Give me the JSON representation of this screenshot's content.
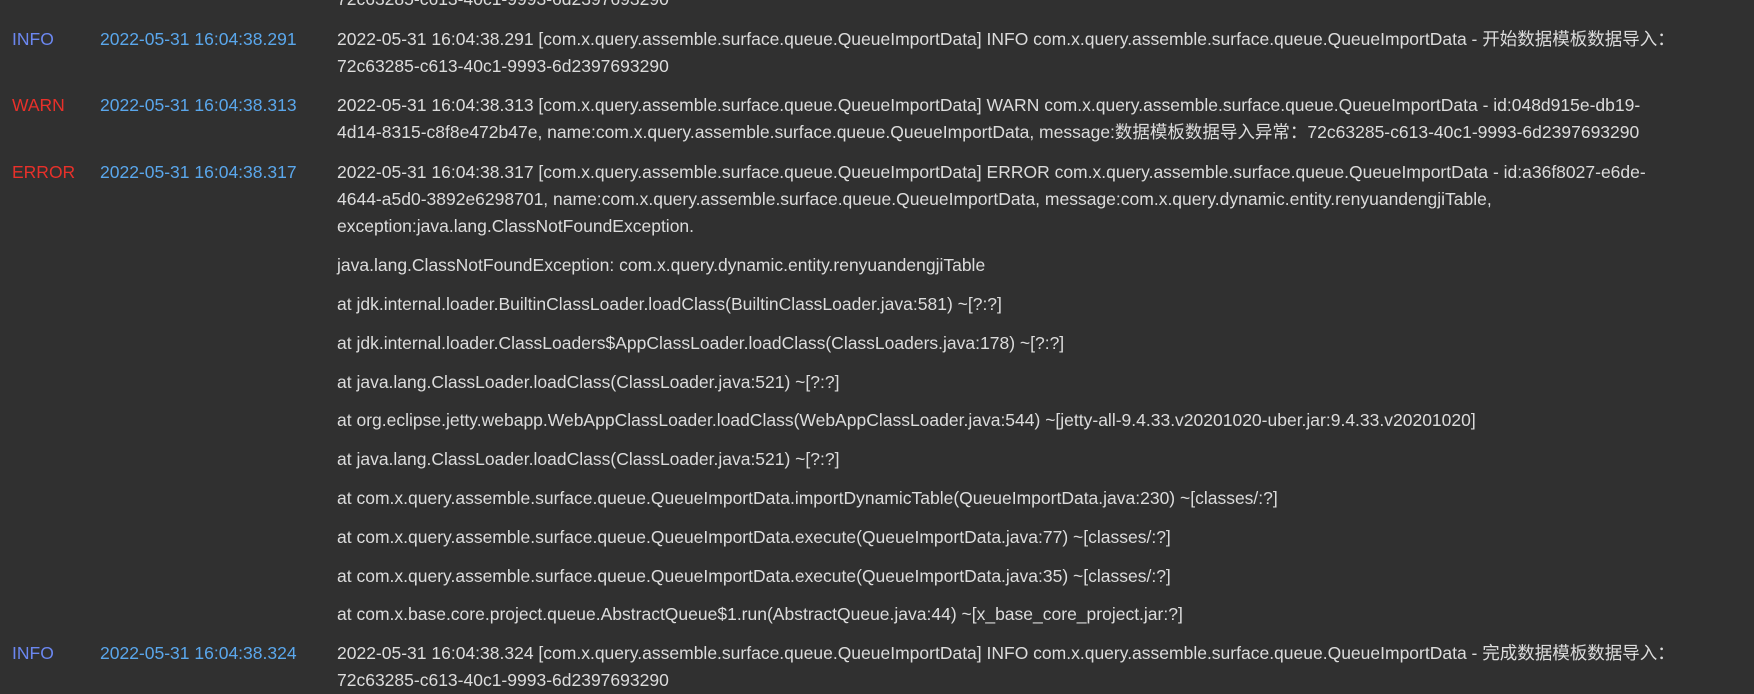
{
  "top_fragment": "72c63285-c613-40c1-9993-6d2397693290",
  "entries": [
    {
      "level": "INFO",
      "time": "2022-05-31 16:04:38.291",
      "message": "2022-05-31 16:04:38.291 [com.x.query.assemble.surface.queue.QueueImportData] INFO com.x.query.assemble.surface.queue.QueueImportData - 开始数据模板数据导入：\n72c63285-c613-40c1-9993-6d2397693290"
    },
    {
      "level": "WARN",
      "time": "2022-05-31 16:04:38.313",
      "message": "2022-05-31 16:04:38.313 [com.x.query.assemble.surface.queue.QueueImportData] WARN com.x.query.assemble.surface.queue.QueueImportData - id:048d915e-db19-\n4d14-8315-c8f8e472b47e, name:com.x.query.assemble.surface.queue.QueueImportData, message:数据模板数据导入异常：72c63285-c613-40c1-9993-6d2397693290"
    },
    {
      "level": "ERROR",
      "time": "2022-05-31 16:04:38.317",
      "message": "2022-05-31 16:04:38.317 [com.x.query.assemble.surface.queue.QueueImportData] ERROR com.x.query.assemble.surface.queue.QueueImportData - id:a36f8027-e6de-\n4644-a5d0-3892e6298701, name:com.x.query.assemble.surface.queue.QueueImportData, message:com.x.query.dynamic.entity.renyuandengjiTable,\nexception:java.lang.ClassNotFoundException.",
      "trace": [
        "java.lang.ClassNotFoundException: com.x.query.dynamic.entity.renyuandengjiTable",
        "at jdk.internal.loader.BuiltinClassLoader.loadClass(BuiltinClassLoader.java:581) ~[?:?]",
        "at jdk.internal.loader.ClassLoaders$AppClassLoader.loadClass(ClassLoaders.java:178) ~[?:?]",
        "at java.lang.ClassLoader.loadClass(ClassLoader.java:521) ~[?:?]",
        "at org.eclipse.jetty.webapp.WebAppClassLoader.loadClass(WebAppClassLoader.java:544) ~[jetty-all-9.4.33.v20201020-uber.jar:9.4.33.v20201020]",
        "at java.lang.ClassLoader.loadClass(ClassLoader.java:521) ~[?:?]",
        "at com.x.query.assemble.surface.queue.QueueImportData.importDynamicTable(QueueImportData.java:230) ~[classes/:?]",
        "at com.x.query.assemble.surface.queue.QueueImportData.execute(QueueImportData.java:77) ~[classes/:?]",
        "at com.x.query.assemble.surface.queue.QueueImportData.execute(QueueImportData.java:35) ~[classes/:?]",
        "at com.x.base.core.project.queue.AbstractQueue$1.run(AbstractQueue.java:44) ~[x_base_core_project.jar:?]"
      ]
    },
    {
      "level": "INFO",
      "time": "2022-05-31 16:04:38.324",
      "message": "2022-05-31 16:04:38.324 [com.x.query.assemble.surface.queue.QueueImportData] INFO com.x.query.assemble.surface.queue.QueueImportData - 完成数据模板数据导入：\n72c63285-c613-40c1-9993-6d2397693290"
    }
  ],
  "colors": {
    "background": "#303030",
    "info": "#6b87f0",
    "warn": "#e8302a",
    "error": "#e8302a",
    "time": "#5aa7ec",
    "text": "#dcdcdc"
  }
}
